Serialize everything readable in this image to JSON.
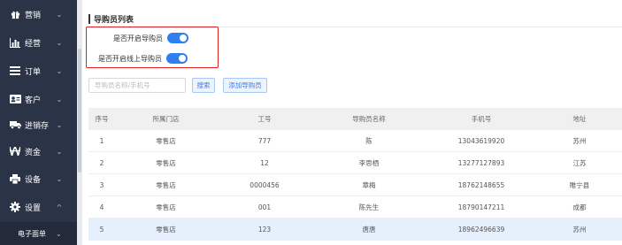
{
  "sidebar": {
    "items": [
      {
        "label": "营销",
        "icon": "gift-icon"
      },
      {
        "label": "经营",
        "icon": "chart-icon"
      },
      {
        "label": "订单",
        "icon": "list-icon"
      },
      {
        "label": "客户",
        "icon": "user-card-icon"
      },
      {
        "label": "进销存",
        "icon": "truck-icon"
      },
      {
        "label": "资金",
        "icon": "won-icon"
      },
      {
        "label": "设备",
        "icon": "printer-icon"
      },
      {
        "label": "设置",
        "icon": "gear-icon",
        "expanded": true
      }
    ],
    "sub_item": "电子面单",
    "chevron_down": "⌄",
    "chevron_up": "^"
  },
  "section": {
    "title": "导购员列表"
  },
  "toggles": {
    "enable_guide": {
      "label": "是否开启导购员",
      "on": true
    },
    "enable_online_guide": {
      "label": "是否开启线上导购员",
      "on": true
    }
  },
  "search": {
    "placeholder": "导购员名称/手机号",
    "search_button": "搜索",
    "add_button": "添加导购员"
  },
  "table": {
    "headers": [
      "序号",
      "所属门店",
      "工号",
      "导购员名称",
      "手机号",
      "地址"
    ],
    "rows": [
      [
        "1",
        "零售店",
        "777",
        "陈",
        "13043619920",
        "苏州"
      ],
      [
        "2",
        "零售店",
        "12",
        "李思栖",
        "13277127893",
        "江苏"
      ],
      [
        "3",
        "零售店",
        "0000456",
        "章梅",
        "18762148655",
        "睢宁县"
      ],
      [
        "4",
        "零售店",
        "001",
        "陈先生",
        "18790147211",
        "成都"
      ],
      [
        "5",
        "零售店",
        "123",
        "唐唐",
        "18962496639",
        "苏州"
      ]
    ],
    "highlighted_row": 5
  },
  "colors": {
    "sidebar_bg": "#2b3446",
    "accent": "#2f7ff0",
    "highlight_box": "#e02020"
  }
}
